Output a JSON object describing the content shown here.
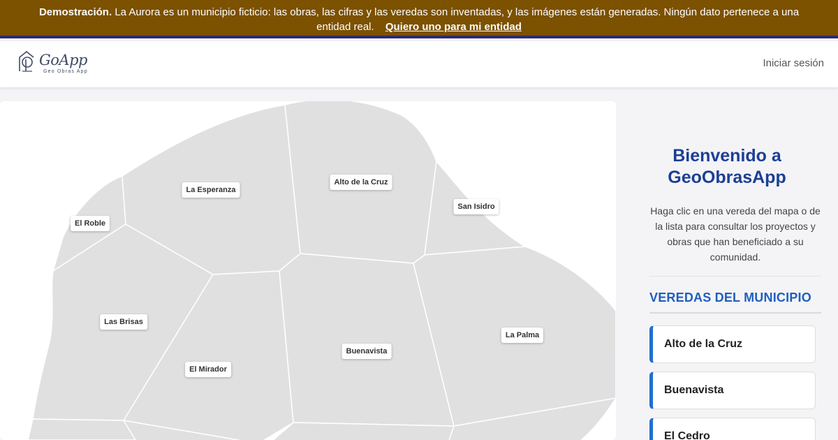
{
  "banner": {
    "bold_label": "Demostración.",
    "text": "La Aurora es un municipio ficticio: las obras, las cifras y las veredas son inventadas, y las imágenes están generadas. Ningún dato pertenece a una entidad real.",
    "link": "Quiero uno para mi entidad",
    "bg_color": "#7c5100"
  },
  "navbar": {
    "logo_text": "GoApp",
    "logo_sub": "Geo Obras App",
    "login": "Iniciar sesión"
  },
  "map": {
    "fill_color": "#e0e0e0",
    "veredas": [
      "La Esperanza",
      "Alto de la Cruz",
      "San Isidro",
      "El Roble",
      "Las Brisas",
      "Buenavista",
      "La Palma",
      "El Mirador"
    ]
  },
  "sidebar": {
    "welcome_title": "Bienvenido a GeoObrasApp",
    "welcome_text": "Haga clic en una vereda del mapa o de la lista para consultar los proyectos y obras que han beneficiado a su comunidad.",
    "section_title": "VEREDAS DEL MUNICIPIO",
    "items": [
      "Alto de la Cruz",
      "Buenavista",
      "El Cedro"
    ],
    "accent_color": "#1f6fcf"
  }
}
